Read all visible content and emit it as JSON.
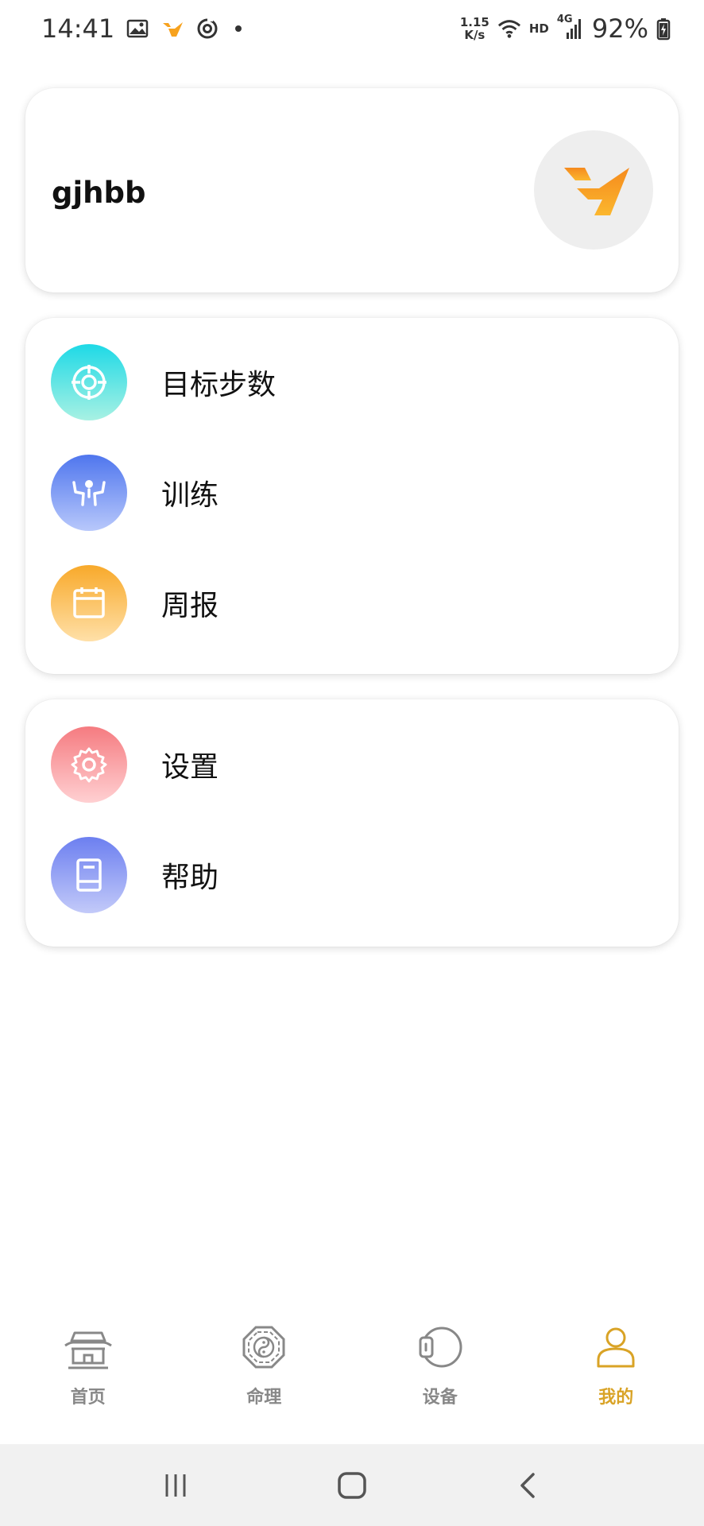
{
  "status_bar": {
    "time": "14:41",
    "speed_value": "1.15",
    "speed_unit": "K/s",
    "hd": "HD",
    "network": "4G",
    "battery": "92%",
    "icons": [
      "image-icon",
      "app-logo-icon",
      "sync-icon",
      "notification-dot",
      "wifi-icon",
      "signal-icon",
      "battery-charging-icon"
    ]
  },
  "profile": {
    "username": "gjhbb",
    "avatar_icon": "app-logo-icon"
  },
  "menu_group_1": {
    "items": [
      {
        "label": "目标步数",
        "icon": "target-icon"
      },
      {
        "label": "训练",
        "icon": "training-icon"
      },
      {
        "label": "周报",
        "icon": "calendar-icon"
      }
    ]
  },
  "menu_group_2": {
    "items": [
      {
        "label": "设置",
        "icon": "gear-icon"
      },
      {
        "label": "帮助",
        "icon": "book-icon"
      }
    ]
  },
  "tabs": [
    {
      "label": "首页",
      "icon": "temple-icon",
      "active": false
    },
    {
      "label": "命理",
      "icon": "bagua-icon",
      "active": false
    },
    {
      "label": "设备",
      "icon": "watch-icon",
      "active": false
    },
    {
      "label": "我的",
      "icon": "person-icon",
      "active": true
    }
  ],
  "colors": {
    "accent": "#d9a326",
    "tab_inactive": "#888888",
    "logo_orange": "#f7a21e"
  },
  "nav_bar": {
    "buttons": [
      "recent-apps-icon",
      "home-icon",
      "back-icon"
    ]
  }
}
